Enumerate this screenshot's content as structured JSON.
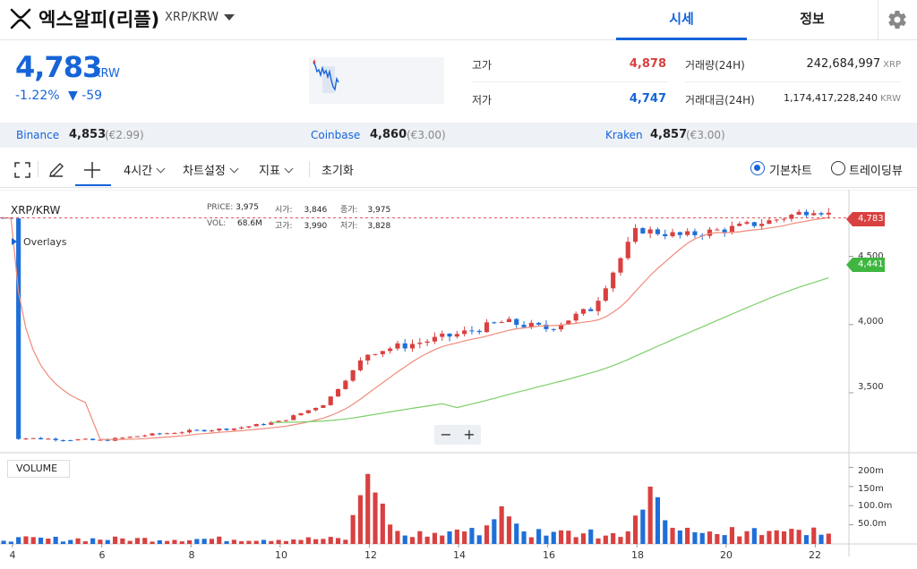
{
  "header": {
    "coin_name": "엑스알피(리플)",
    "pair": "XRP/KRW",
    "tabs": [
      "시세",
      "정보"
    ]
  },
  "summary": {
    "price": "4,783",
    "unit": "KRW",
    "change_rate": "-1.22%",
    "change_amount": "▼ -59",
    "high_label": "고가",
    "high_value": "4,878",
    "low_label": "저가",
    "low_value": "4,747",
    "volume_label": "거래량(24H)",
    "volume_value": "242,684,997",
    "volume_unit": "XRP",
    "turnover_label": "거래대금(24H)",
    "turnover_value": "1,174,417,228,240",
    "turnover_unit": "KRW"
  },
  "exchanges": [
    {
      "name": "Binance",
      "price": "4,853",
      "fx": "(€2.99)"
    },
    {
      "name": "Coinbase",
      "price": "4,860",
      "fx": "(€3.00)"
    },
    {
      "name": "Kraken",
      "price": "4,857",
      "fx": "(€3.00)"
    }
  ],
  "toolbar": {
    "interval": "4시간",
    "chart_settings": "차트설정",
    "indicators": "지표",
    "reset": "초기화",
    "basic_chart": "기본차트",
    "tradingview": "트레이딩뷰"
  },
  "chart": {
    "legend_pair": "XRP/KRW",
    "overlays": "Overlays",
    "ohlc": {
      "price_label": "PRICE:",
      "price": "3,975",
      "open_label": "시가:",
      "open": "3,846",
      "close_label": "종가:",
      "close": "3,975",
      "vol_label": "VOL:",
      "vol": "68.6M",
      "high_label": "고가:",
      "high": "3,990",
      "low_label": "저가:",
      "low": "3,828"
    },
    "last_price_tag": "4,783",
    "ma_tag": "4,441",
    "volume_label": "VOLUME",
    "zoom_out": "−",
    "zoom_in": "+",
    "y_ticks": [
      "4,500",
      "4,000",
      "3,500"
    ],
    "vol_ticks": [
      "200m",
      "150m",
      "100.0m",
      "50.0m"
    ],
    "x_ticks": [
      "4",
      "6",
      "8",
      "10",
      "12",
      "14",
      "16",
      "18",
      "20",
      "22"
    ]
  },
  "colors": {
    "accent": "#1664d8",
    "up": "#d94040",
    "down": "#1f6fd8",
    "ma_short": "#f08a7a",
    "ma_long": "#7ccf6a"
  },
  "chart_data": {
    "type": "candlestick",
    "title": "XRP/KRW",
    "x_ticks": [
      "4",
      "6",
      "8",
      "10",
      "12",
      "14",
      "16",
      "18",
      "20",
      "22"
    ],
    "ylim": [
      3100,
      4950
    ],
    "y_ticks": [
      3500,
      4000,
      4500
    ],
    "vol_ticks_m": [
      50,
      100,
      150,
      200
    ],
    "last_price": 4783,
    "ma_long_last": 4441,
    "approx_close_path": [
      {
        "x": "4",
        "close": 3170
      },
      {
        "x": "6",
        "close": 3150
      },
      {
        "x": "7",
        "close": 3190
      },
      {
        "x": "8",
        "close": 3220
      },
      {
        "x": "9",
        "close": 3240
      },
      {
        "x": "10",
        "close": 3290
      },
      {
        "x": "11",
        "close": 3420
      },
      {
        "x": "12",
        "close": 3800
      },
      {
        "x": "13",
        "close": 3860
      },
      {
        "x": "14",
        "close": 3930
      },
      {
        "x": "15",
        "close": 4020
      },
      {
        "x": "16",
        "close": 3970
      },
      {
        "x": "17",
        "close": 4120
      },
      {
        "x": "18",
        "close": 4700
      },
      {
        "x": "19",
        "close": 4650
      },
      {
        "x": "20",
        "close": 4700
      },
      {
        "x": "21",
        "close": 4760
      },
      {
        "x": "22",
        "close": 4850
      },
      {
        "x": "22.5",
        "close": 4783
      }
    ],
    "volume_peaks_m": [
      {
        "x": "12",
        "volume": 200
      },
      {
        "x": "15",
        "volume": 110
      },
      {
        "x": "18.3",
        "volume": 165
      }
    ]
  }
}
